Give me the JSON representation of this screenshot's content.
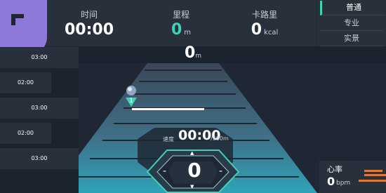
{
  "stats": {
    "time": {
      "label": "时间",
      "value": "00:00"
    },
    "distance": {
      "label": "里程",
      "value": "0",
      "unit": "m"
    },
    "calories": {
      "label": "卡路里",
      "value": "0",
      "unit": "kcal"
    }
  },
  "modes": [
    {
      "label": "普通",
      "active": true
    },
    {
      "label": "专业",
      "active": false
    },
    {
      "label": "实景",
      "active": false
    }
  ],
  "splits": [
    "03:00",
    "02:00",
    "03:00",
    "02:00",
    "03:00"
  ],
  "progress": {
    "distance": "0",
    "unit": "m",
    "rider_number": "1"
  },
  "speed": {
    "label": "速度",
    "value": "00:00",
    "unit": "/500m"
  },
  "gear": {
    "value": "0",
    "minus": "-",
    "plus": "-"
  },
  "heart_rate": {
    "label": "心率",
    "value": "0",
    "unit": "bpm"
  },
  "colors": {
    "accent": "#3fd3b6",
    "corner": "#8e79d8",
    "heart_rate_bar": "#e07a3c"
  }
}
